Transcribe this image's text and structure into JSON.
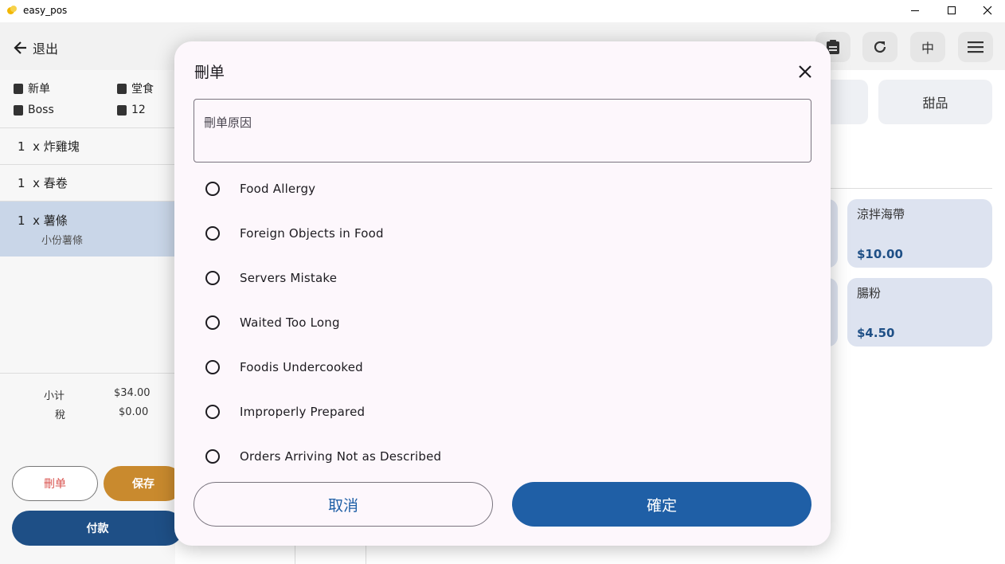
{
  "window": {
    "title": "easy_pos"
  },
  "topbar": {
    "back_label": "退出",
    "language_label": "中"
  },
  "order": {
    "type_label": "新单",
    "dine_label": "堂食",
    "staff_label": "Boss",
    "table_label": "12",
    "items": [
      {
        "qty": "1",
        "x": "x",
        "name": "炸雞塊",
        "note": ""
      },
      {
        "qty": "1",
        "x": "x",
        "name": "春卷",
        "note": ""
      },
      {
        "qty": "1",
        "x": "x",
        "name": "薯條",
        "note": "小份薯條"
      }
    ],
    "subtotal_label": "小计",
    "subtotal_value": "$34.00",
    "tax_label": "稅",
    "tax_value": "$0.00",
    "delete_label": "刪单",
    "save_label": "保存",
    "pay_label": "付款"
  },
  "menu": {
    "category_dessert": "甜品",
    "tiles": [
      {
        "name": "涼拌海帶",
        "price": "$10.00"
      },
      {
        "name": "腸粉",
        "price": "$4.50"
      }
    ]
  },
  "dialog": {
    "title": "刪单",
    "reason_placeholder": "刪单原因",
    "options": [
      "Food Allergy",
      "Foreign Objects in Food",
      "Servers Mistake",
      "Waited Too Long",
      "Foodis Undercooked",
      "Improperly Prepared",
      "Orders Arriving Not as Described"
    ],
    "cancel_label": "取消",
    "confirm_label": "確定"
  },
  "colors": {
    "primary": "#1f5fa6",
    "dialog_bg": "#fdf7fc",
    "save_orange": "#c98a2e",
    "pay_navy": "#1e4f86"
  }
}
